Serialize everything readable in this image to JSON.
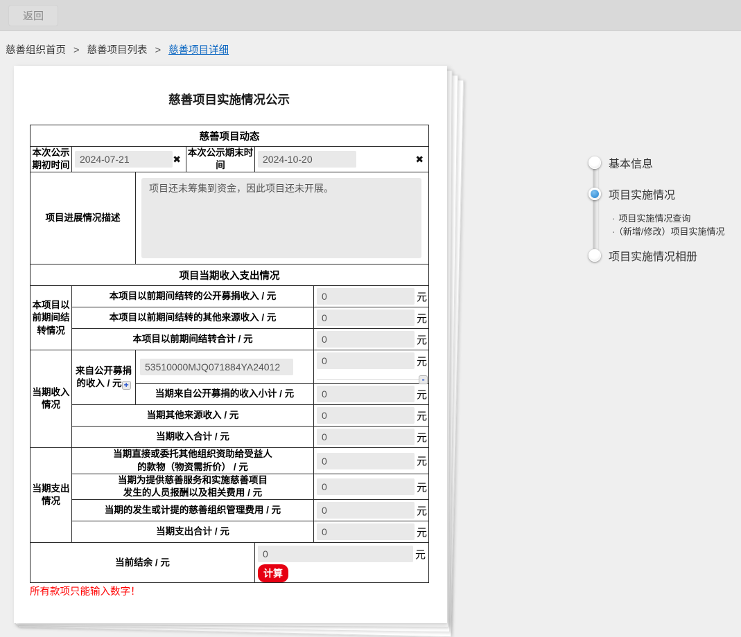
{
  "topbar": {
    "back_label": "返回"
  },
  "breadcrumb": {
    "separator": ">",
    "home": "慈善组织首页",
    "list": "慈善项目列表",
    "detail": "慈善项目详细"
  },
  "panel": {
    "title": "慈善项目实施情况公示",
    "dynamics_header": "慈善项目动态",
    "period_start_label": "本次公示期初时间",
    "period_start_value": "2024-07-21",
    "period_end_label": "本次公示期末时间",
    "period_end_value": "2024-10-20",
    "clear_icon": "✖",
    "progress_label": "项目进展情况描述",
    "progress_value": "项目还未筹集到资金，因此项目还未开展。",
    "finance_header": "项目当期收入支出情况",
    "unit": "元",
    "carryover": {
      "group_label": "本项目以前期间结转情况",
      "row1_label": "本项目以前期间结转的公开募捐收入 / 元",
      "row1_value": "0",
      "row2_label": "本项目以前期间结转的其他来源收入 / 元",
      "row2_value": "0",
      "row3_label": "本项目以前期间结转合计 / 元",
      "row3_value": "0"
    },
    "income": {
      "group_label": "当期收入情况",
      "public_label": "来自公开募捐的收入 / 元",
      "plus_icon": "+",
      "minus_icon": "-",
      "code_value": "53510000MJQ071884YA24012",
      "code_amount": "0",
      "subtotal_label": "当期来自公开募捐的收入小计 / 元",
      "subtotal_value": "0",
      "other_label": "当期其他来源收入 / 元",
      "other_value": "0",
      "total_label": "当期收入合计 / 元",
      "total_value": "0"
    },
    "expense": {
      "group_label": "当期支出情况",
      "row1_line1": "当期直接或委托其他组织资助给受益人",
      "row1_line2": "的款物（物资需折价） / 元",
      "row1_value": "0",
      "row2_line1": "当期为提供慈善服务和实施慈善项目",
      "row2_line2": "发生的人员报酬以及相关费用 / 元",
      "row2_value": "0",
      "row3_label": "当期的发生或计提的慈善组织管理费用 / 元",
      "row3_value": "0",
      "row4_label": "当期支出合计 / 元",
      "row4_value": "0"
    },
    "balance": {
      "label": "当前结余 / 元",
      "value": "0",
      "calc_label": "计算"
    },
    "warning": "所有款项只能输入数字！"
  },
  "stepper": {
    "bullet": "·",
    "step1": "基本信息",
    "step2": "项目实施情况",
    "step2_sub1": "项目实施情况查询",
    "step2_sub2": "（新增/修改）项目实施情况",
    "step3": "项目实施情况相册"
  },
  "colors": {
    "accent_blue": "#3b92d8",
    "link_blue": "#0563c1",
    "calc_red": "#e60012",
    "warning_red": "#ff0000"
  }
}
